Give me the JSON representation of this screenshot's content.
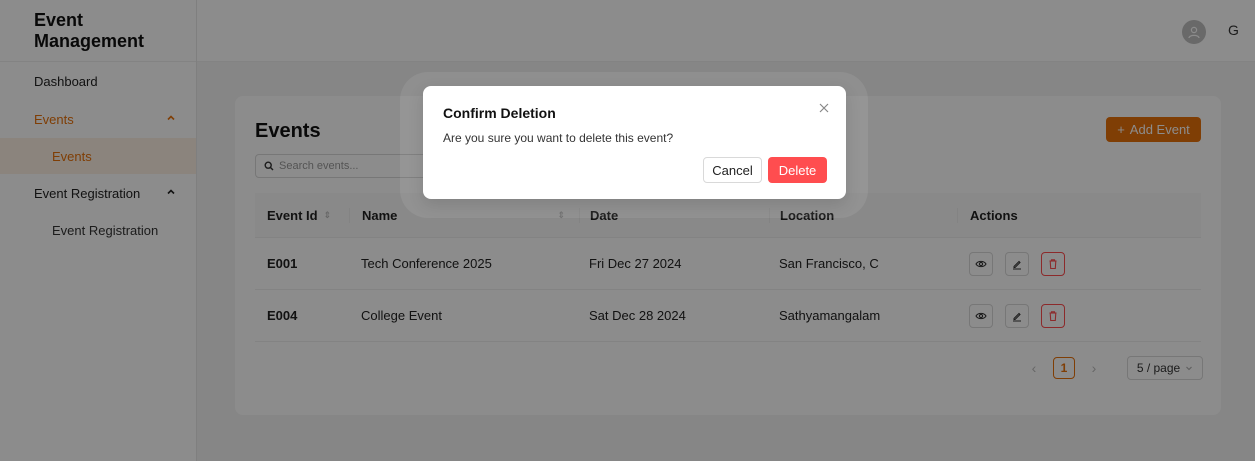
{
  "sidebar": {
    "brand": "Event Management",
    "items": [
      {
        "label": "Dashboard"
      },
      {
        "label": "Events",
        "expanded": true,
        "children": [
          {
            "label": "Events",
            "active": true
          }
        ]
      },
      {
        "label": "Event Registration",
        "expanded": true,
        "children": [
          {
            "label": "Event Registration"
          }
        ]
      }
    ]
  },
  "header": {
    "user_initial": "G"
  },
  "page": {
    "title": "Events",
    "add_button_label": "Add Event",
    "search_placeholder": "Search events..."
  },
  "table": {
    "columns": [
      "Event Id",
      "Name",
      "Date",
      "Location",
      "Actions"
    ],
    "rows": [
      {
        "id": "E001",
        "name": "Tech Conference 2025",
        "date": "Fri Dec 27 2024",
        "location": "San Francisco, C"
      },
      {
        "id": "E004",
        "name": "College Event",
        "date": "Sat Dec 28 2024",
        "location": "Sathyamangalam"
      }
    ]
  },
  "pagination": {
    "current_page": "1",
    "page_size": "5 / page"
  },
  "modal": {
    "title": "Confirm Deletion",
    "body": "Are you sure you want to delete this event?",
    "cancel_label": "Cancel",
    "delete_label": "Delete"
  },
  "colors": {
    "accent": "#e8710a",
    "danger": "#ff4d4f"
  }
}
